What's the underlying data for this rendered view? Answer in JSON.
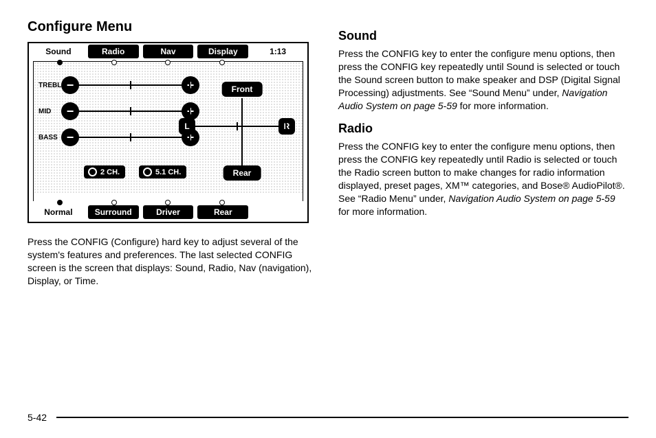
{
  "left": {
    "heading": "Configure Menu",
    "paragraph": "Press the CONFIG (Configure) hard key to adjust several of the system's features and preferences. The last selected CONFIG screen is the screen that displays: Sound, Radio, Nav (navigation), Display, or Time."
  },
  "diagram": {
    "top_tabs": [
      "Sound",
      "Radio",
      "Nav",
      "Display",
      "1:13"
    ],
    "sliders": [
      "TREBLE",
      "MID",
      "BASS"
    ],
    "balance_left": "L",
    "balance_right": "R",
    "pill_front": "Front",
    "pill_rear": "Rear",
    "ch2": "2 CH.",
    "ch51": "5.1 CH.",
    "bottom_tabs": [
      "Normal",
      "Surround",
      "Driver",
      "Rear"
    ]
  },
  "right": {
    "sound_heading": "Sound",
    "sound_p1": "Press the CONFIG key to enter the configure menu options, then press the CONFIG key repeatedly until Sound is selected or touch the Sound screen button to make speaker and DSP (Digital Signal Processing) adjustments. See “Sound Menu” under, ",
    "sound_ref": "Navigation Audio System on page 5-59",
    "sound_p2": " for more information.",
    "radio_heading": "Radio",
    "radio_p1": "Press the CONFIG key to enter the configure menu options, then press the CONFIG key repeatedly until Radio is selected or touch the Radio screen button to make changes for radio information displayed, preset pages, XM™ categories, and Bose® AudioPilot®. See “Radio Menu” under, ",
    "radio_ref": "Navigation Audio System on page 5-59",
    "radio_p2": " for more information."
  },
  "page_number": "5-42"
}
